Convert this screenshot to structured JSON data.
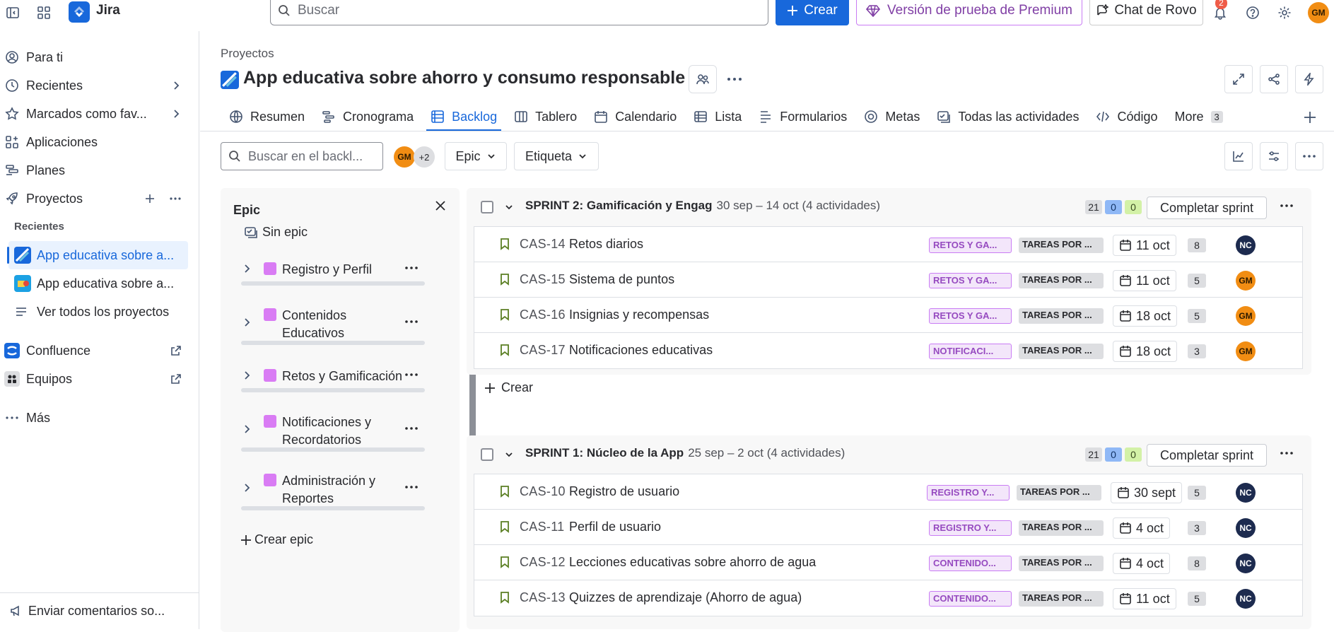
{
  "topbar": {
    "app_name": "Jira",
    "search_placeholder": "Buscar",
    "create_label": "Crear",
    "premium_label": "Versión de prueba de Premium",
    "rovo_label": "Chat de Rovo",
    "notifications_count": "2",
    "user_initials": "GM"
  },
  "sidebar": {
    "items": [
      {
        "label": "Para ti"
      },
      {
        "label": "Recientes"
      },
      {
        "label": "Marcados como fav..."
      },
      {
        "label": "Aplicaciones"
      },
      {
        "label": "Planes"
      },
      {
        "label": "Proyectos"
      }
    ],
    "recent_heading": "Recientes",
    "recent_projects": [
      {
        "label": "App educativa sobre a..."
      },
      {
        "label": "App educativa sobre a..."
      }
    ],
    "view_all": "Ver todos los proyectos",
    "confluence": "Confluence",
    "teams": "Equipos",
    "more": "Más",
    "feedback": "Enviar comentarios so..."
  },
  "project": {
    "breadcrumb": "Proyectos",
    "title": "App educativa sobre ahorro y consumo responsable"
  },
  "tabs": [
    {
      "label": "Resumen",
      "icon": "globe-icon"
    },
    {
      "label": "Cronograma",
      "icon": "timeline-icon"
    },
    {
      "label": "Backlog",
      "icon": "backlog-icon",
      "active": true
    },
    {
      "label": "Tablero",
      "icon": "board-icon"
    },
    {
      "label": "Calendario",
      "icon": "calendar-icon"
    },
    {
      "label": "Lista",
      "icon": "list-icon"
    },
    {
      "label": "Formularios",
      "icon": "forms-icon"
    },
    {
      "label": "Metas",
      "icon": "goal-icon"
    },
    {
      "label": "Todas las actividades",
      "icon": "activities-icon"
    },
    {
      "label": "Código",
      "icon": "code-icon"
    }
  ],
  "tabs_more": {
    "label": "More",
    "count": "3"
  },
  "toolbar": {
    "backlog_search_placeholder": "Buscar en el backl...",
    "avatar_initials": "GM",
    "more_people": "+2",
    "epic_filter": "Epic",
    "label_filter": "Etiqueta"
  },
  "epic_panel": {
    "title": "Epic",
    "no_epic": "Sin epic",
    "epics": [
      {
        "name": "Registro y Perfil"
      },
      {
        "name": "Contenidos Educativos"
      },
      {
        "name": "Retos y Gamificación"
      },
      {
        "name": "Notificaciones y Recordatorios"
      },
      {
        "name": "Administración y Reportes"
      }
    ],
    "create_epic": "Crear epic"
  },
  "sprints": [
    {
      "title": "SPRINT 2: Gamificación y Engag",
      "dates": "30 sep – 14 oct (4 actividades)",
      "counts": [
        "21",
        "0",
        "0"
      ],
      "complete_label": "Completar sprint",
      "create_label": "Crear",
      "issues": [
        {
          "key": "CAS-14",
          "summary": "Retos diarios",
          "epic": "RETOS Y GA...",
          "status": "TAREAS POR ...",
          "date": "11 oct",
          "points": "8",
          "assignee": "NC"
        },
        {
          "key": "CAS-15",
          "summary": "Sistema de puntos",
          "epic": "RETOS Y GA...",
          "status": "TAREAS POR ...",
          "date": "11 oct",
          "points": "5",
          "assignee": "GM"
        },
        {
          "key": "CAS-16",
          "summary": "Insignias y recompensas",
          "epic": "RETOS Y GA...",
          "status": "TAREAS POR ...",
          "date": "18 oct",
          "points": "5",
          "assignee": "GM"
        },
        {
          "key": "CAS-17",
          "summary": "Notificaciones educativas",
          "epic": "NOTIFICACI...",
          "status": "TAREAS POR ...",
          "date": "18 oct",
          "points": "3",
          "assignee": "GM"
        }
      ]
    },
    {
      "title": "SPRINT 1: Núcleo de la App",
      "dates": "25 sep – 2 oct (4 actividades)",
      "counts": [
        "21",
        "0",
        "0"
      ],
      "complete_label": "Completar sprint",
      "issues": [
        {
          "key": "CAS-10",
          "summary": "Registro de usuario",
          "epic": "REGISTRO Y...",
          "status": "TAREAS POR ...",
          "date": "30 sept",
          "points": "5",
          "assignee": "NC"
        },
        {
          "key": "CAS-11",
          "summary": "Perfil de usuario",
          "epic": "REGISTRO Y...",
          "status": "TAREAS POR ...",
          "date": "4 oct",
          "points": "3",
          "assignee": "NC"
        },
        {
          "key": "CAS-12",
          "summary": "Lecciones educativas sobre ahorro de agua",
          "epic": "CONTENIDO...",
          "status": "TAREAS POR ...",
          "date": "4 oct",
          "points": "8",
          "assignee": "NC"
        },
        {
          "key": "CAS-13",
          "summary": "Quizzes de aprendizaje (Ahorro de agua)",
          "epic": "CONTENIDO...",
          "status": "TAREAS POR ...",
          "date": "11 oct",
          "points": "5",
          "assignee": "NC"
        }
      ]
    }
  ],
  "colors": {
    "brand": "#1868db",
    "epic": "#d97cf4",
    "avatar_gm": "#f18d13",
    "avatar_nc": "#1d2b4f"
  }
}
